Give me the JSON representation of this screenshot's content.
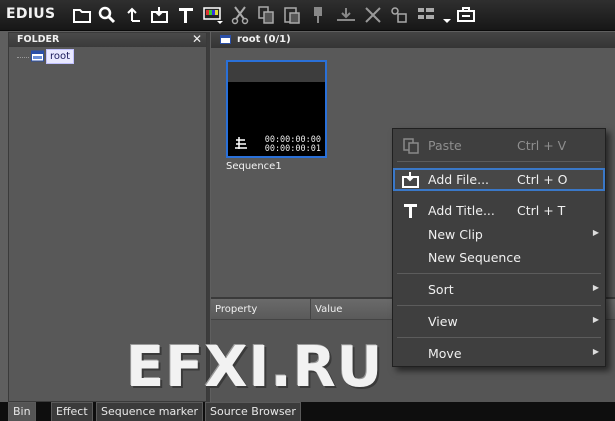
{
  "app": {
    "title": "EDIUS"
  },
  "toolbar": {
    "icons": [
      "open-folder-icon",
      "search-icon",
      "up-arrow-icon",
      "add-file-icon",
      "title-icon",
      "color-bar-icon",
      "cut-icon",
      "copy-icon",
      "paste-icon",
      "marker-icon",
      "timeline-insert-icon",
      "delete-icon",
      "properties-icon",
      "view-mode-icon",
      "dropdown-arrow-icon",
      "bin-icon"
    ]
  },
  "folder_panel": {
    "title": "FOLDER",
    "close_glyph": "✕",
    "tree": [
      {
        "label": "root"
      }
    ]
  },
  "clip_panel": {
    "header": "root (0/1)",
    "clips": [
      {
        "name": "Sequence1",
        "timecode_in": "00:00:00:00",
        "timecode_out": "00:00:00:01"
      }
    ]
  },
  "property_panel": {
    "columns": [
      "Property",
      "Value"
    ]
  },
  "tabs": [
    {
      "label": "Bin",
      "active": true
    },
    {
      "label": "Effect",
      "active": false
    },
    {
      "label": "Sequence marker",
      "active": false
    },
    {
      "label": "Source Browser",
      "active": false
    }
  ],
  "context_menu": {
    "items": [
      {
        "label": "Paste",
        "shortcut": "Ctrl + V",
        "icon": "paste-icon",
        "disabled": true
      },
      {
        "label": "Add File...",
        "shortcut": "Ctrl + O",
        "icon": "add-file-icon",
        "highlighted": true
      },
      {
        "label": "Add Title...",
        "shortcut": "Ctrl + T",
        "icon": "title-icon"
      },
      {
        "label": "New Clip",
        "submenu": true
      },
      {
        "label": "New Sequence"
      },
      {
        "label": "Sort",
        "submenu": true
      },
      {
        "label": "View",
        "submenu": true
      },
      {
        "label": "Move",
        "submenu": true
      }
    ]
  },
  "watermark": "EFXI.RU",
  "colors": {
    "accent": "#2a70d8",
    "menu_bg": "#3f3f3f",
    "panel_bg": "#595959"
  }
}
